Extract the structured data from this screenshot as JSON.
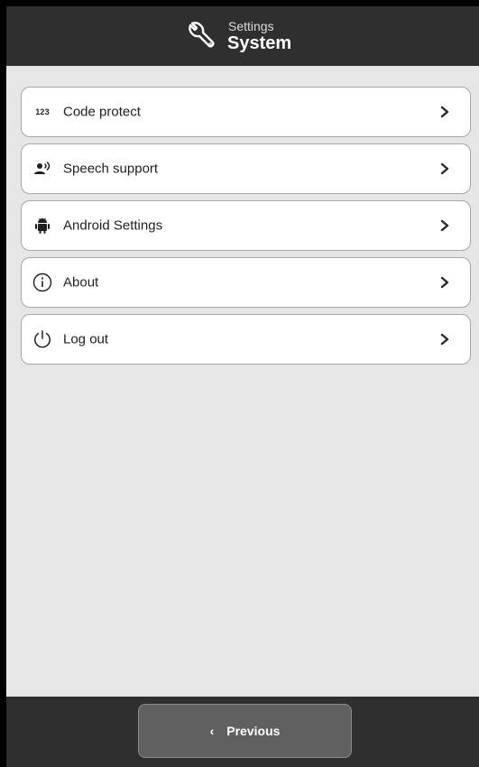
{
  "header": {
    "subtitle": "Settings",
    "title": "System",
    "icon": "wrench-icon"
  },
  "menu": {
    "items": [
      {
        "label": "Code protect",
        "icon": "code-123-icon",
        "icon_text": "123"
      },
      {
        "label": "Speech support",
        "icon": "speech-icon"
      },
      {
        "label": "Android Settings",
        "icon": "android-icon"
      },
      {
        "label": "About",
        "icon": "info-icon"
      },
      {
        "label": "Log out",
        "icon": "power-icon"
      }
    ]
  },
  "footer": {
    "previous_label": "Previous",
    "previous_chevron": "‹"
  },
  "colors": {
    "header_bg": "#2f2f2f",
    "content_bg": "#e6e6e6",
    "card_bg": "#ffffff",
    "button_bg": "#606060"
  }
}
